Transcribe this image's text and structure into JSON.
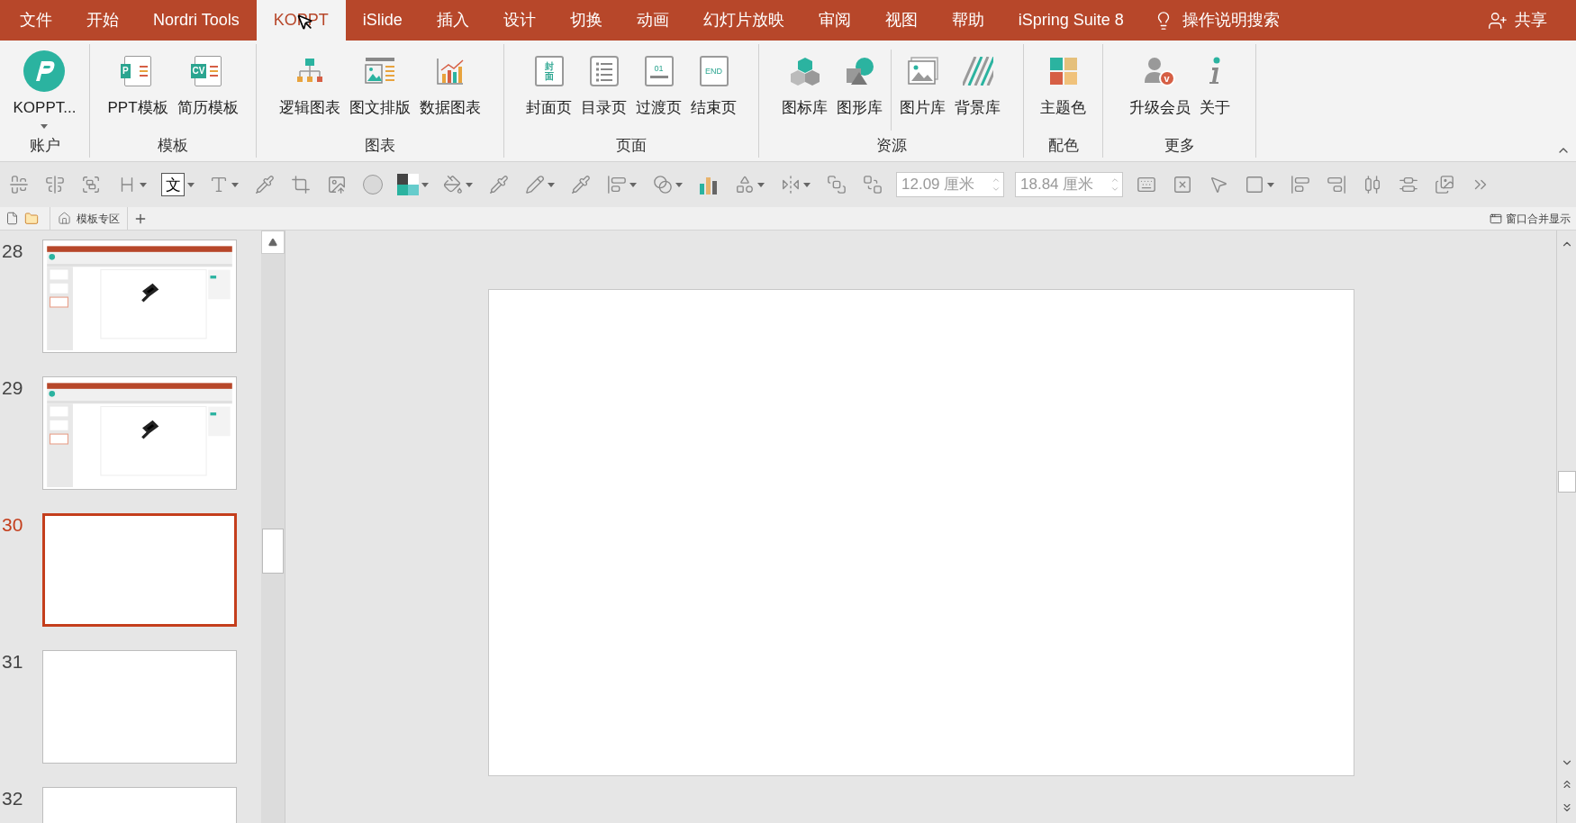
{
  "tabs": [
    {
      "label": "文件",
      "selected": false
    },
    {
      "label": "开始",
      "selected": false
    },
    {
      "label": "Nordri Tools",
      "selected": false
    },
    {
      "label": "KOPPT",
      "selected": true
    },
    {
      "label": "iSlide",
      "selected": false
    },
    {
      "label": "插入",
      "selected": false
    },
    {
      "label": "设计",
      "selected": false
    },
    {
      "label": "切换",
      "selected": false
    },
    {
      "label": "动画",
      "selected": false
    },
    {
      "label": "幻灯片放映",
      "selected": false
    },
    {
      "label": "审阅",
      "selected": false
    },
    {
      "label": "视图",
      "selected": false
    },
    {
      "label": "帮助",
      "selected": false
    },
    {
      "label": "iSpring Suite 8",
      "selected": false
    }
  ],
  "tell_me": "操作说明搜索",
  "share": "共享",
  "ribbon": {
    "groups": [
      {
        "label": "账户",
        "buttons": [
          {
            "label": "KOPPT...",
            "dropdown": true
          }
        ]
      },
      {
        "label": "模板",
        "buttons": [
          {
            "label": "PPT模板",
            "icon_text": "P"
          },
          {
            "label": "简历模板",
            "icon_text": "CV"
          }
        ]
      },
      {
        "label": "图表",
        "buttons": [
          {
            "label": "逻辑图表"
          },
          {
            "label": "图文排版"
          },
          {
            "label": "数据图表"
          }
        ]
      },
      {
        "label": "页面",
        "buttons": [
          {
            "label": "封面页",
            "icon_text": "封面"
          },
          {
            "label": "目录页"
          },
          {
            "label": "过渡页",
            "icon_text": "01"
          },
          {
            "label": "结束页",
            "icon_text": "END"
          }
        ]
      },
      {
        "label": "资源",
        "buttons": [
          {
            "label": "图标库"
          },
          {
            "label": "图形库"
          },
          {
            "label": "图片库",
            "divider_before": true
          },
          {
            "label": "背景库"
          }
        ]
      },
      {
        "label": "配色",
        "buttons": [
          {
            "label": "主题色"
          }
        ]
      },
      {
        "label": "更多",
        "buttons": [
          {
            "label": "升级会员",
            "icon_text": "v"
          },
          {
            "label": "关于"
          }
        ]
      }
    ]
  },
  "toolbar": {
    "glyph": "文",
    "fields": [
      {
        "value": "12.09 厘米"
      },
      {
        "value": "18.84 厘米"
      }
    ]
  },
  "doc_tabs": [
    {
      "label": "模板专区"
    }
  ],
  "window_merge": "窗口合并显示",
  "slides": [
    {
      "number": "28",
      "selected": false,
      "kind": "screenshot"
    },
    {
      "number": "29",
      "selected": false,
      "kind": "screenshot"
    },
    {
      "number": "30",
      "selected": true,
      "kind": "blank"
    },
    {
      "number": "31",
      "selected": false,
      "kind": "blank"
    },
    {
      "number": "32",
      "selected": false,
      "kind": "blank"
    }
  ]
}
